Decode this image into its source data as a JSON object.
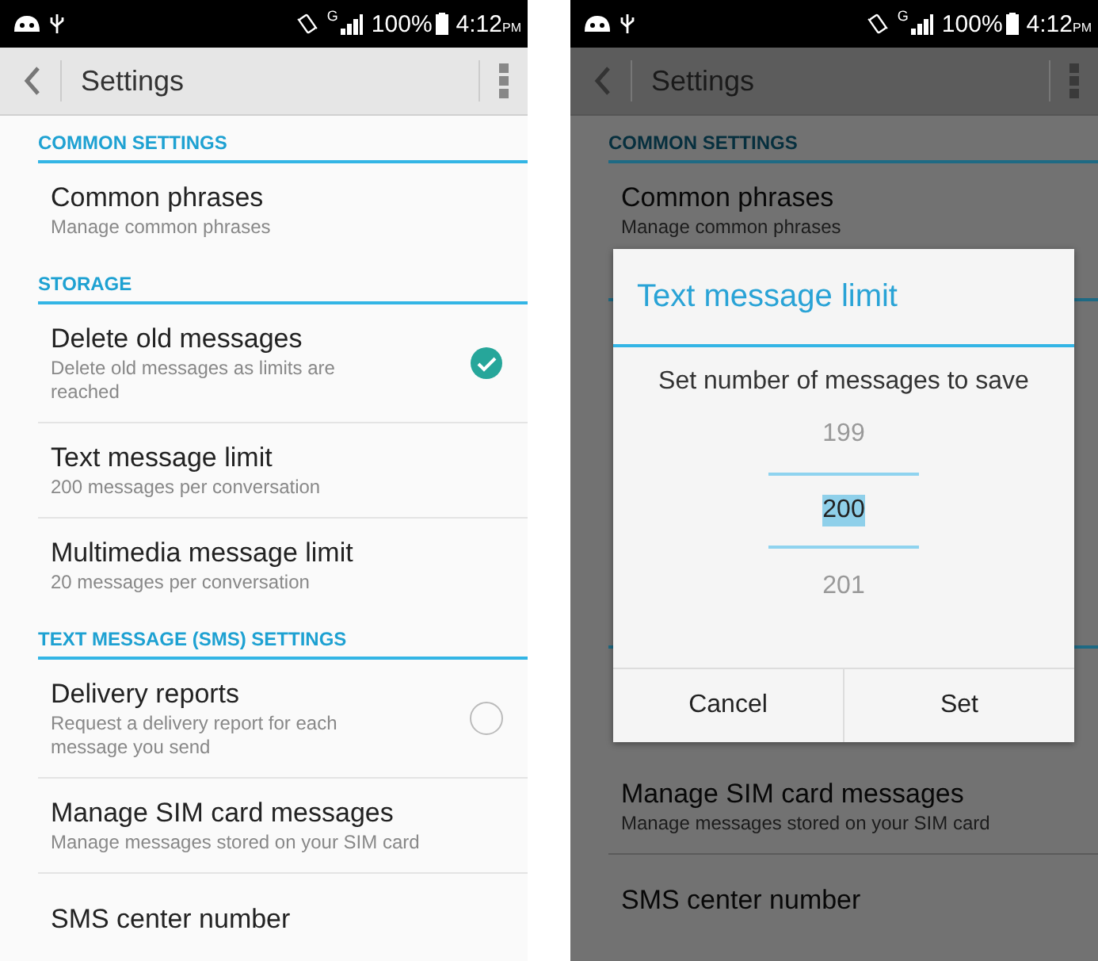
{
  "screens": [
    {
      "dimmed": false,
      "status_bar": {
        "network": "G",
        "battery": "100%",
        "time": "4:12",
        "ampm": "PM"
      },
      "toolbar": {
        "title": "Settings"
      },
      "list": [
        {
          "kind": "header",
          "title": "COMMON SETTINGS"
        },
        {
          "kind": "item",
          "title": "Common phrases",
          "subtitle": "Manage common phrases",
          "divider": false
        },
        {
          "kind": "header",
          "title": "STORAGE"
        },
        {
          "kind": "checkbox",
          "title": "Delete old messages",
          "subtitle": "Delete old messages as limits are reached",
          "checked": true,
          "divider": true
        },
        {
          "kind": "item",
          "title": "Text message limit",
          "subtitle": "200 messages per conversation",
          "divider": true
        },
        {
          "kind": "item",
          "title": "Multimedia message limit",
          "subtitle": "20 messages per conversation",
          "divider": false
        },
        {
          "kind": "header",
          "title": "TEXT MESSAGE (SMS) SETTINGS"
        },
        {
          "kind": "checkbox",
          "title": "Delivery reports",
          "subtitle": "Request a delivery report for each message you send",
          "checked": false,
          "divider": true
        },
        {
          "kind": "item",
          "title": "Manage SIM card messages",
          "subtitle": "Manage messages stored on your SIM card",
          "divider": true
        },
        {
          "kind": "item",
          "title": "SMS center number",
          "divider": false
        }
      ]
    },
    {
      "dimmed": true,
      "status_bar": {
        "network": "G",
        "battery": "100%",
        "time": "4:12",
        "ampm": "PM"
      },
      "toolbar": {
        "title": "Settings"
      },
      "list": [
        {
          "kind": "header",
          "title": "COMMON SETTINGS"
        },
        {
          "kind": "item",
          "title": "Common phrases",
          "subtitle": "Manage common phrases",
          "divider": false
        }
      ],
      "dialog": {
        "title": "Text message limit",
        "message": "Set number of messages to save",
        "picker": [
          {
            "text": "199",
            "selected": false
          },
          {
            "text": "200",
            "selected": true
          },
          {
            "text": "201",
            "selected": false
          }
        ],
        "buttons": [
          "Cancel",
          "Set"
        ]
      },
      "list_after": [
        {
          "kind": "item",
          "title": "Manage SIM card messages",
          "subtitle": "Manage messages stored on your SIM card",
          "divider": true
        },
        {
          "kind": "item",
          "title": "SMS center number",
          "divider": false
        }
      ]
    }
  ]
}
